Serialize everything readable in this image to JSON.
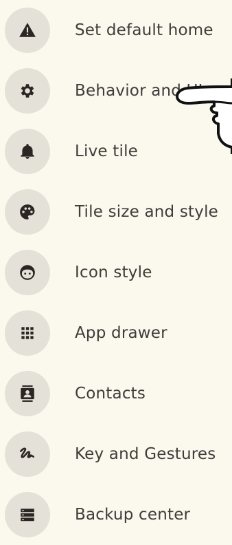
{
  "settings": {
    "items": [
      {
        "label": "Set default home",
        "icon": "warning-triangle-icon"
      },
      {
        "label": "Behavior and UI",
        "icon": "gear-icon"
      },
      {
        "label": "Live tile",
        "icon": "bell-icon"
      },
      {
        "label": "Tile size and style",
        "icon": "palette-icon"
      },
      {
        "label": "Icon style",
        "icon": "face-icon"
      },
      {
        "label": "App drawer",
        "icon": "apps-grid-icon"
      },
      {
        "label": "Contacts",
        "icon": "contacts-book-icon"
      },
      {
        "label": "Key and Gestures",
        "icon": "gesture-icon"
      },
      {
        "label": "Backup center",
        "icon": "storage-icon"
      }
    ]
  },
  "colors": {
    "background": "#FBF8EE",
    "icon_circle": "#E4E1D8",
    "icon_glyph": "#2B2623",
    "text": "#3F3C3A"
  }
}
